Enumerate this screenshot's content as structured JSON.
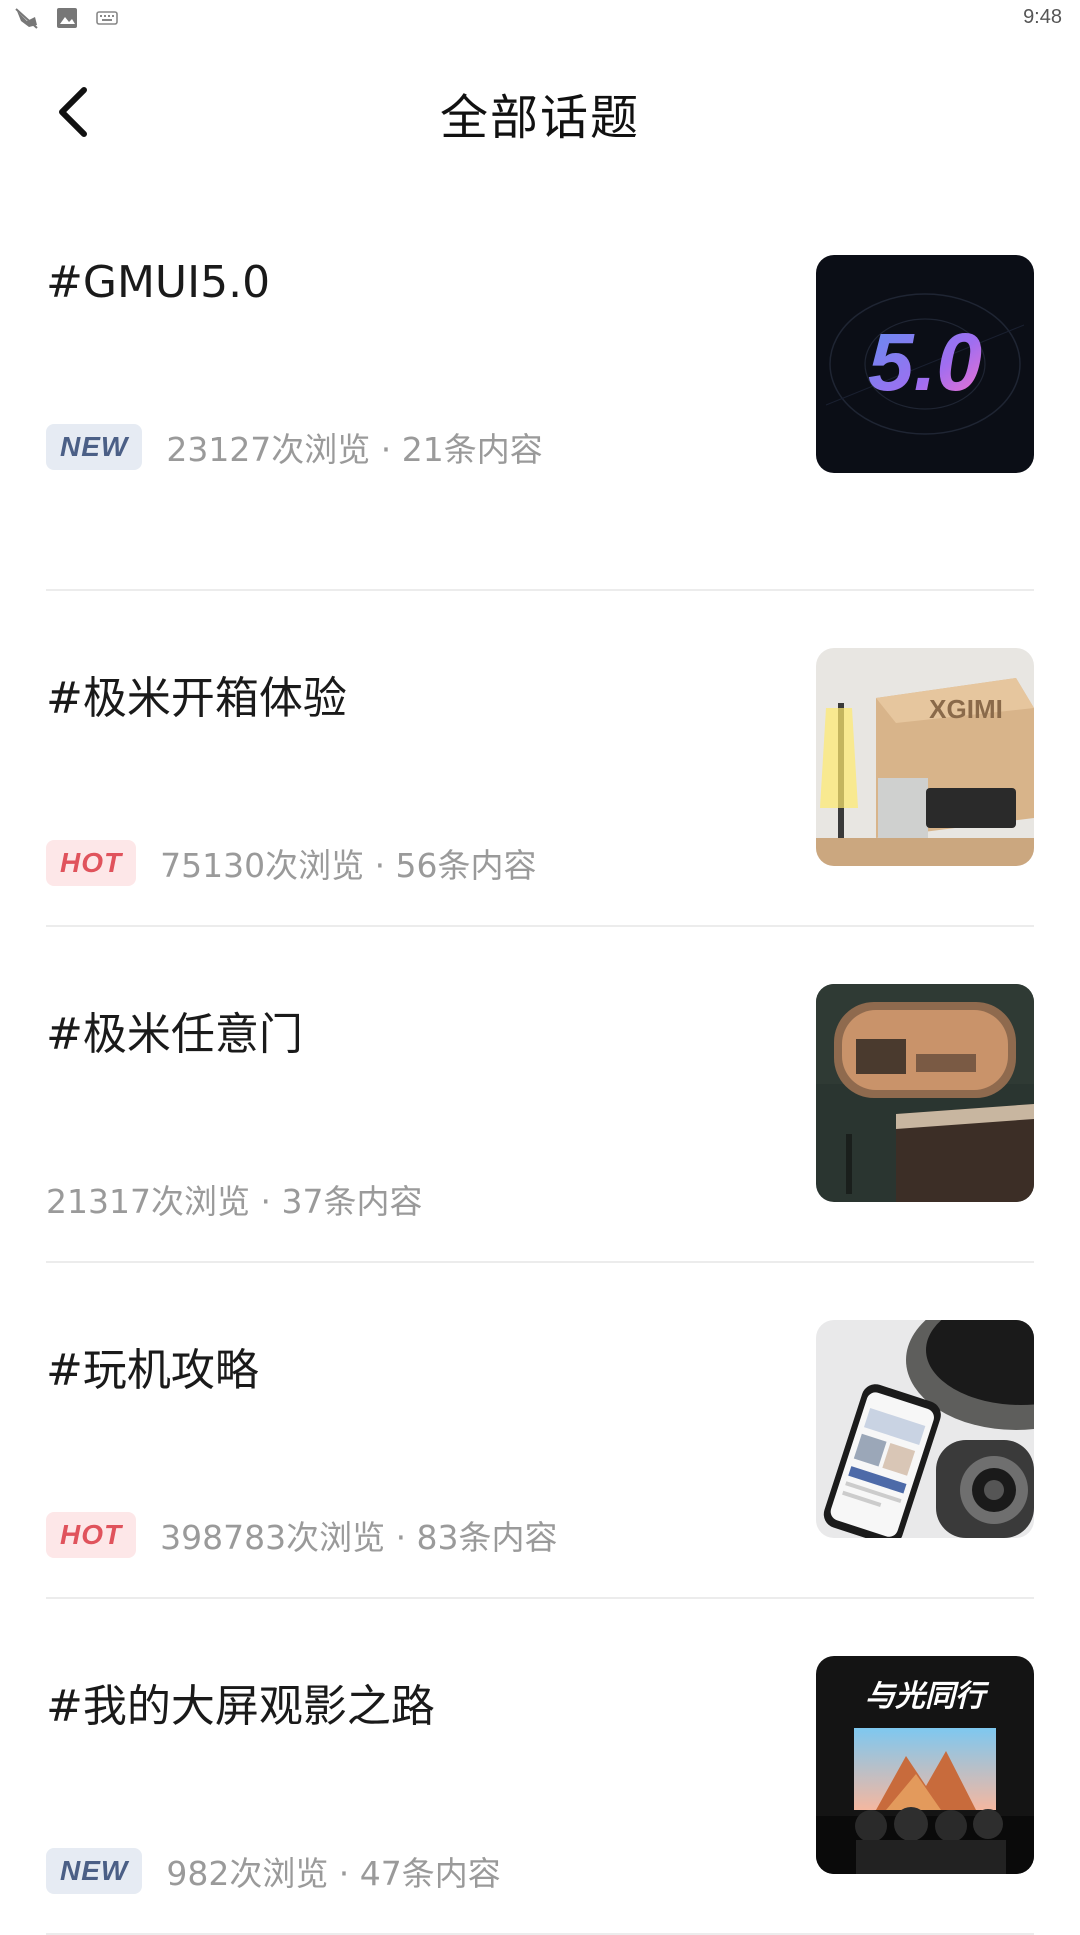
{
  "status_bar": {
    "time": "9:48",
    "icons": [
      "bird-icon",
      "image-icon",
      "keyboard-icon"
    ]
  },
  "header": {
    "title": "全部话题",
    "back_icon": "chevron-left-icon"
  },
  "topics": [
    {
      "title": "#GMUI5.0",
      "badge": "NEW",
      "badge_type": "new",
      "meta": "23127次浏览 · 21条内容",
      "thumb_text": "5.0"
    },
    {
      "title": "#极米开箱体验",
      "badge": "HOT",
      "badge_type": "hot",
      "meta": "75130次浏览 · 56条内容",
      "thumb_text": "XGIMI"
    },
    {
      "title": "#极米任意门",
      "badge": "",
      "badge_type": "none",
      "meta": "21317次浏览 · 37条内容",
      "thumb_text": ""
    },
    {
      "title": "#玩机攻略",
      "badge": "HOT",
      "badge_type": "hot",
      "meta": "398783次浏览 · 83条内容",
      "thumb_text": ""
    },
    {
      "title": "#我的大屏观影之路",
      "badge": "NEW",
      "badge_type": "new",
      "meta": "982次浏览 · 47条内容",
      "thumb_text": "与光同行"
    }
  ],
  "colors": {
    "badge_new_bg": "#e6ebf3",
    "badge_new_text": "#4b5f86",
    "badge_hot_bg": "#fde7e8",
    "badge_hot_text": "#e0535c",
    "meta_text": "#9a9a9a",
    "divider": "#ececec"
  }
}
